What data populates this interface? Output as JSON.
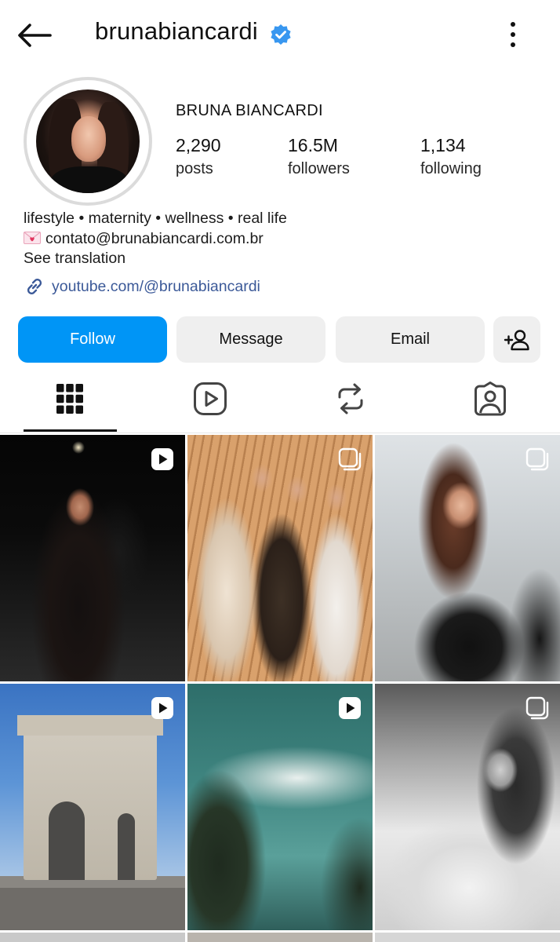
{
  "header": {
    "username": "brunabiancardi",
    "verified": true,
    "back_icon": "arrow-left-icon",
    "more_icon": "more-vertical-icon"
  },
  "profile": {
    "full_name": "BRUNA BIANCARDI",
    "stats": [
      {
        "value": "2,290",
        "label": "posts"
      },
      {
        "value": "16.5M",
        "label": "followers"
      },
      {
        "value": "1,134",
        "label": "following"
      }
    ],
    "bio_line1": "lifestyle • maternity • wellness • real life",
    "bio_email": "contato@brunabiancardi.com.br",
    "see_translation": "See translation",
    "link": "youtube.com/@brunabiancardi"
  },
  "actions": {
    "follow": "Follow",
    "message": "Message",
    "email": "Email",
    "add_user_icon": "add-user-icon"
  },
  "tabs": [
    {
      "icon": "grid-icon",
      "selected": true
    },
    {
      "icon": "reels-icon",
      "selected": false
    },
    {
      "icon": "reposts-icon",
      "selected": false
    },
    {
      "icon": "tagged-icon",
      "selected": false
    }
  ],
  "grid": [
    {
      "type": "reel"
    },
    {
      "type": "carousel"
    },
    {
      "type": "carousel"
    },
    {
      "type": "reel"
    },
    {
      "type": "reel"
    },
    {
      "type": "carousel"
    }
  ],
  "colors": {
    "accent": "#0095f6",
    "verified": "#3897f0",
    "link": "#3b5998",
    "button_secondary": "#efefef"
  }
}
